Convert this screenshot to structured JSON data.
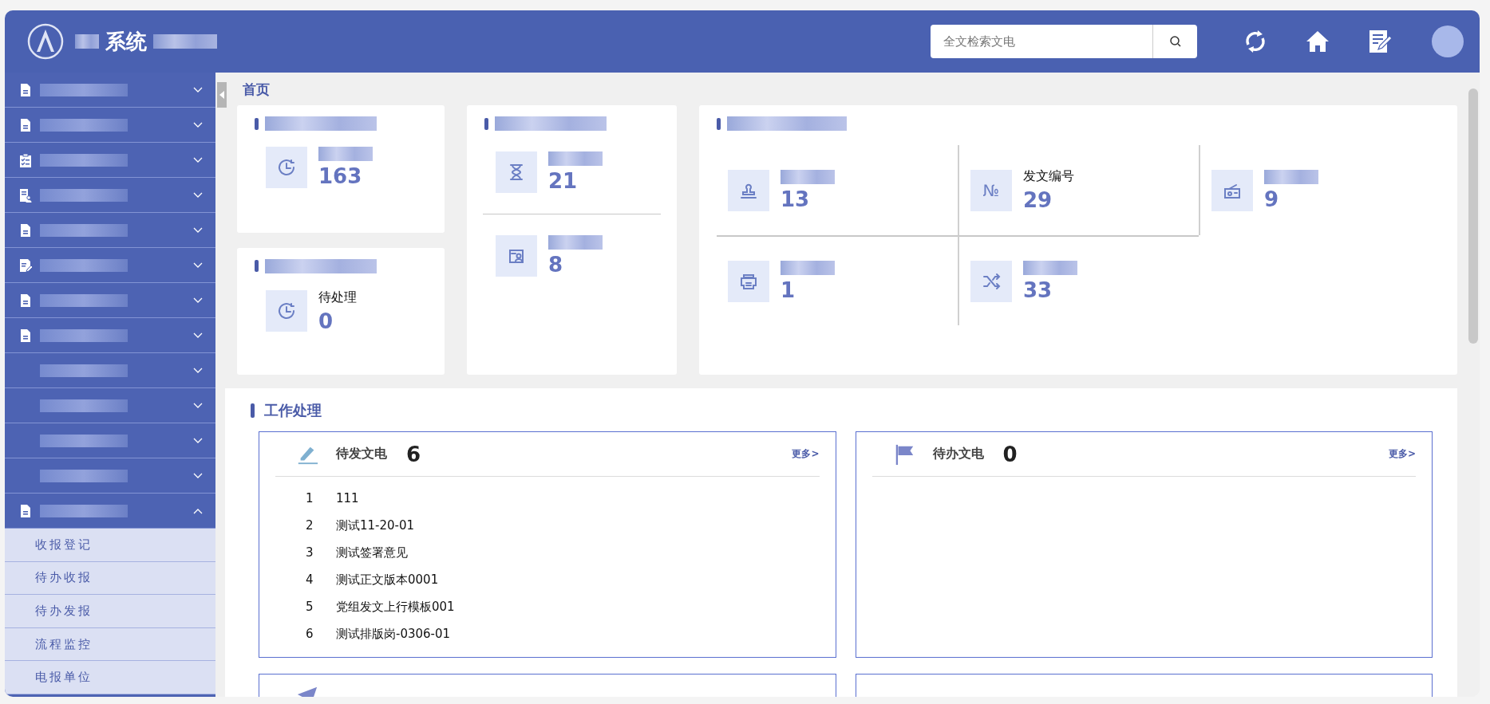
{
  "header": {
    "title": "系统",
    "search": {
      "placeholder": "全文检索文电"
    }
  },
  "sidebar": {
    "items": [
      {
        "expanded": false
      },
      {
        "expanded": false
      },
      {
        "expanded": false
      },
      {
        "expanded": false
      },
      {
        "expanded": false
      },
      {
        "expanded": false
      },
      {
        "expanded": false
      },
      {
        "expanded": false
      },
      {
        "expanded": false
      },
      {
        "expanded": false
      },
      {
        "expanded": false
      },
      {
        "expanded": false
      },
      {
        "expanded": true,
        "children": [
          {
            "label": "收报登记"
          },
          {
            "label": "待办收报"
          },
          {
            "label": "待办发报"
          },
          {
            "label": "流程监控"
          },
          {
            "label": "电报单位"
          }
        ]
      }
    ]
  },
  "page_title": "首页",
  "stat_cards": [
    {
      "stats": [
        {
          "value": "163"
        }
      ]
    },
    {
      "stats": [
        {
          "label": "待处理",
          "value": "0"
        }
      ]
    },
    {
      "stats": [
        {
          "value": "21"
        },
        {
          "value": "8"
        }
      ]
    },
    {
      "stats": [
        {
          "value": "13"
        },
        {
          "glyph": "№",
          "label": "发文编号",
          "value": "29"
        },
        {
          "value": "9"
        },
        {
          "value": "1"
        },
        {
          "value": "33"
        }
      ]
    }
  ],
  "work": {
    "title": "工作处理",
    "boxes": [
      {
        "title": "待发文电",
        "count": "6",
        "more": "更多>",
        "rows": [
          {
            "index": "1",
            "text": "111"
          },
          {
            "index": "2",
            "text": "测试11-20-01"
          },
          {
            "index": "3",
            "text": "测试签署意见"
          },
          {
            "index": "4",
            "text": "测试正文版本0001"
          },
          {
            "index": "5",
            "text": "党组发文上行模板001"
          },
          {
            "index": "6",
            "text": "测试排版岗-0306-01"
          }
        ]
      },
      {
        "title": "待办文电",
        "count": "0",
        "more": "更多>"
      }
    ]
  }
}
